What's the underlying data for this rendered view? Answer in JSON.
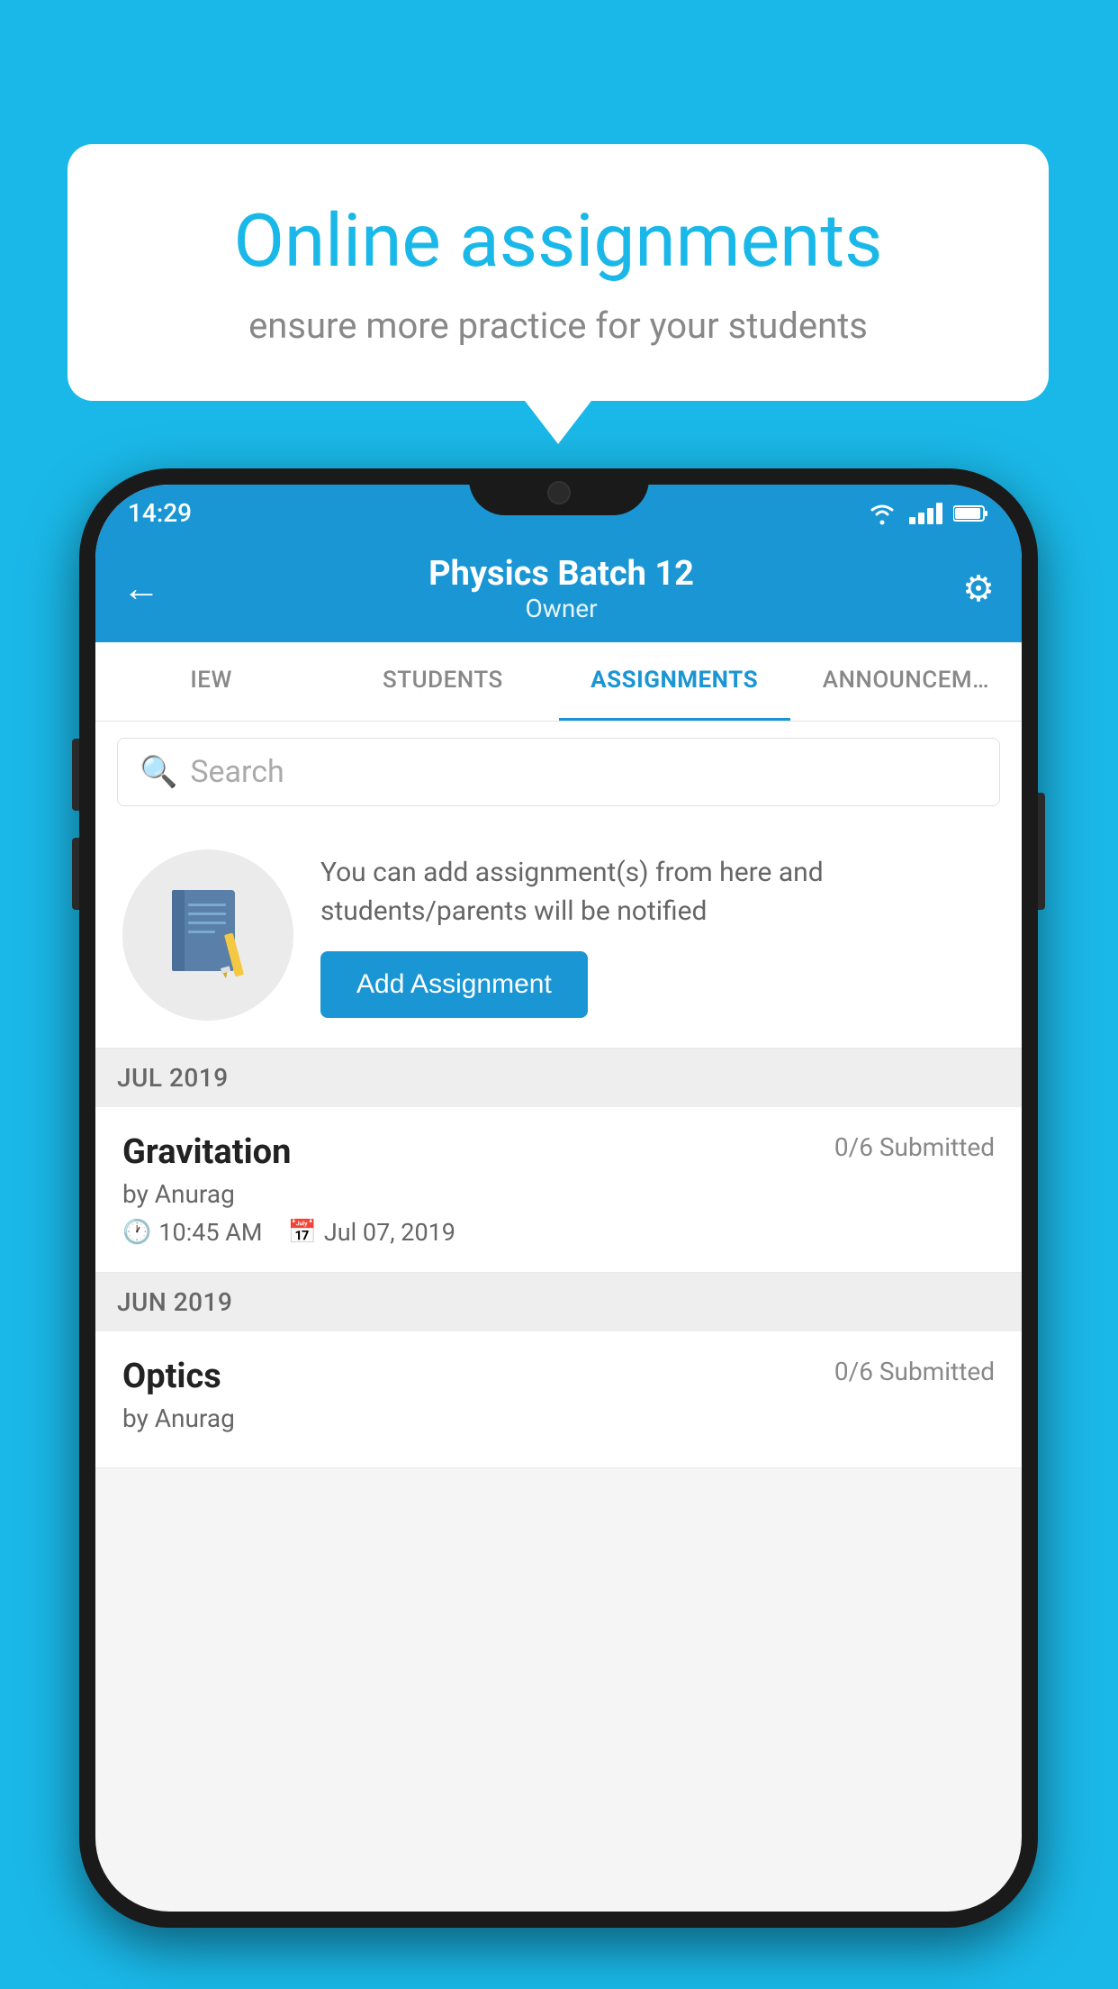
{
  "background_color": "#1ab8e8",
  "speech_bubble": {
    "title": "Online assignments",
    "subtitle": "ensure more practice for your students"
  },
  "status_bar": {
    "time": "14:29"
  },
  "header": {
    "title": "Physics Batch 12",
    "subtitle": "Owner",
    "back_label": "←",
    "settings_label": "⚙"
  },
  "tabs": [
    {
      "label": "IEW",
      "active": false
    },
    {
      "label": "STUDENTS",
      "active": false
    },
    {
      "label": "ASSIGNMENTS",
      "active": true
    },
    {
      "label": "ANNOUNCEM…",
      "active": false
    }
  ],
  "search": {
    "placeholder": "Search"
  },
  "info_card": {
    "description": "You can add assignment(s) from here and students/parents will be notified",
    "button_label": "Add Assignment"
  },
  "sections": [
    {
      "label": "JUL 2019",
      "assignments": [
        {
          "title": "Gravitation",
          "submitted": "0/6 Submitted",
          "author": "by Anurag",
          "time": "10:45 AM",
          "date": "Jul 07, 2019"
        }
      ]
    },
    {
      "label": "JUN 2019",
      "assignments": [
        {
          "title": "Optics",
          "submitted": "0/6 Submitted",
          "author": "by Anurag",
          "time": "",
          "date": ""
        }
      ]
    }
  ]
}
